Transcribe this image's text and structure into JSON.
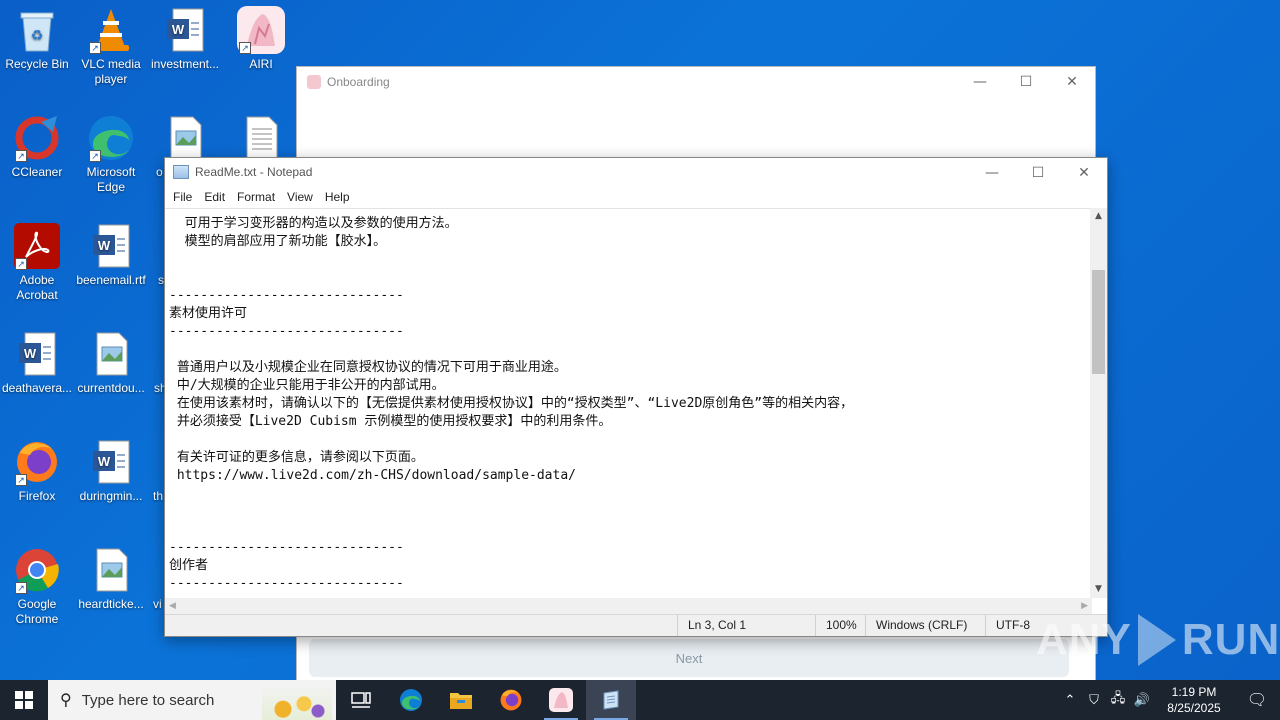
{
  "desktop": {
    "icons": [
      {
        "label": "Recycle Bin",
        "icon": "recycle-bin-icon"
      },
      {
        "label": "VLC media player",
        "icon": "vlc-icon"
      },
      {
        "label": "investment...",
        "icon": "word-doc-icon"
      },
      {
        "label": "AIRI",
        "icon": "airi-icon"
      },
      {
        "label": "CCleaner",
        "icon": "ccleaner-icon"
      },
      {
        "label": "Microsoft Edge",
        "icon": "edge-icon"
      },
      {
        "label": "o",
        "icon": "image-file-icon"
      },
      {
        "label": "Adobe Acrobat",
        "icon": "acrobat-icon"
      },
      {
        "label": "beenemail.rtf",
        "icon": "word-doc-icon"
      },
      {
        "label": "s",
        "icon": "file-icon"
      },
      {
        "label": "deathavera...",
        "icon": "word-doc-icon"
      },
      {
        "label": "currentdou...",
        "icon": "image-file-icon"
      },
      {
        "label": "sh",
        "icon": "file-icon"
      },
      {
        "label": "Firefox",
        "icon": "firefox-icon"
      },
      {
        "label": "duringmin...",
        "icon": "word-doc-icon"
      },
      {
        "label": "th",
        "icon": "file-icon"
      },
      {
        "label": "Google Chrome",
        "icon": "chrome-icon"
      },
      {
        "label": "heardticke...",
        "icon": "image-file-icon"
      },
      {
        "label": "vi",
        "icon": "file-icon"
      }
    ]
  },
  "onboarding": {
    "title": "Onboarding",
    "next_label": "Next"
  },
  "notepad": {
    "title": "ReadMe.txt - Notepad",
    "menu": [
      "File",
      "Edit",
      "Format",
      "View",
      "Help"
    ],
    "lines": [
      "  可用于学习变形器的构造以及参数的使用方法。",
      "  模型的肩部应用了新功能【胶水】。",
      "",
      "",
      "------------------------------",
      "素材使用许可",
      "------------------------------",
      "",
      " 普通用户以及小规模企业在同意授权协议的情况下可用于商业用途。",
      " 中/大规模的企业只能用于非公开的内部试用。",
      " 在使用该素材时，请确认以下的【无偿提供素材使用授权协议】中的“授权类型”、“Live2D原创角色”等的相关内容，",
      " 并必须接受【Live2D Cubism 示例模型的使用授权要求】中的利用条件。",
      "",
      " 有关许可证的更多信息，请参阅以下页面。",
      " https://www.live2d.com/zh-CHS/download/sample-data/",
      "",
      "",
      "",
      "------------------------------",
      "创作者",
      "------------------------------"
    ],
    "status": {
      "position": "Ln 3, Col 1",
      "zoom": "100%",
      "line_ending": "Windows (CRLF)",
      "encoding": "UTF-8"
    }
  },
  "watermark": {
    "left": "ANY",
    "right": "RUN"
  },
  "taskbar": {
    "search_placeholder": "Type here to search",
    "time": "1:19 PM",
    "date": "8/25/2025"
  }
}
